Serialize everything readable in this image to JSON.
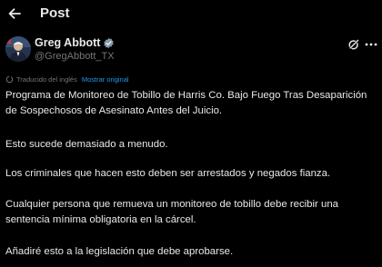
{
  "header": {
    "title": "Post",
    "back_icon": "arrow-left-icon"
  },
  "author": {
    "name": "Greg Abbott",
    "handle": "@GregAbbott_TX",
    "verified_icon": "verified-badge-icon",
    "verified_color": "#829aab"
  },
  "actions": {
    "grok_icon": "grok-icon",
    "more_icon": "more-horizontal-icon"
  },
  "translation": {
    "label": "Traducido del inglés",
    "show_original": "Mostrar original",
    "icon": "translate-icon"
  },
  "post": {
    "paragraphs": [
      "Programa de Monitoreo de Tobillo de Harris Co. Bajo Fuego Tras Desaparición de Sospechosos de Asesinato Antes del Juicio.",
      "Esto sucede demasiado a menudo.",
      "Los criminales que hacen esto deben ser arrestados y negados fianza.",
      "Cualquier persona que remueva un monitoreo de tobillo debe recibir una sentencia mínima obligatoria en la cárcel.",
      "Añadiré esto a la legislación que debe aprobarse."
    ]
  },
  "colors": {
    "background": "#000000",
    "text": "#e7e9ea",
    "muted": "#71767b",
    "link": "#1d9bf0"
  }
}
